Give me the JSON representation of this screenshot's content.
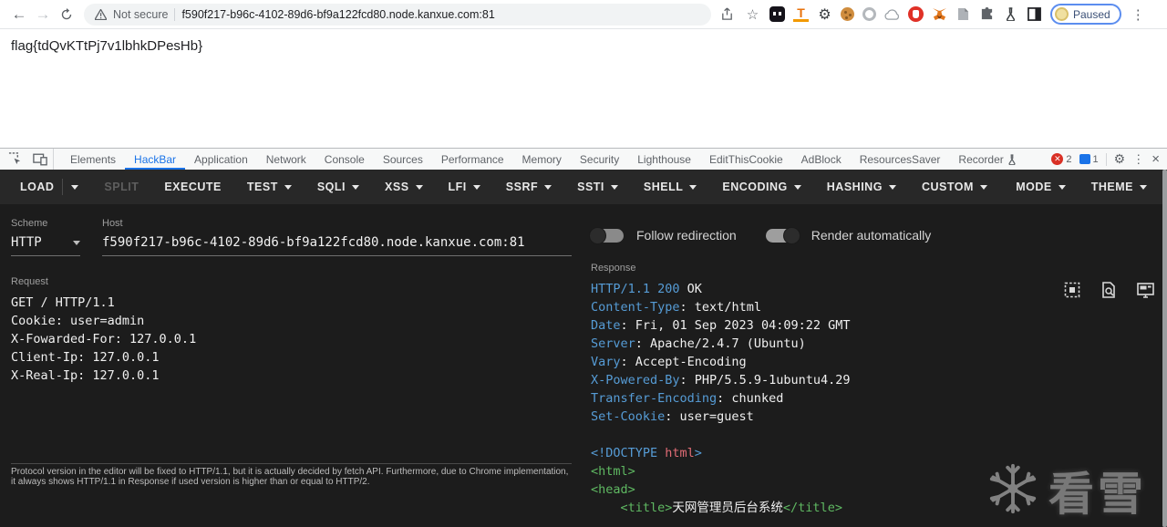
{
  "browser": {
    "back_icon": "←",
    "forward_icon": "→",
    "security_label": "Not secure",
    "url": "f590f217-b96c-4102-89d6-bf9a122fcd80.node.kanxue.com:81",
    "star_icon": "☆",
    "kebab_icon": "⋮",
    "profile_label": "Paused",
    "extension_icons": [
      "dark-reader",
      "orange-t",
      "gear",
      "cookie",
      "gray-ring",
      "cloud",
      "red-hand",
      "metamask-fox",
      "document",
      "puzzle",
      "flask",
      "split-window"
    ]
  },
  "page": {
    "flag_text": "flag{tdQvKTtPj7v1lbhkDPesHb}"
  },
  "devtools": {
    "tabs": [
      {
        "label": "Elements"
      },
      {
        "label": "HackBar",
        "active": true
      },
      {
        "label": "Application"
      },
      {
        "label": "Network"
      },
      {
        "label": "Console"
      },
      {
        "label": "Sources"
      },
      {
        "label": "Performance"
      },
      {
        "label": "Memory"
      },
      {
        "label": "Security"
      },
      {
        "label": "Lighthouse"
      },
      {
        "label": "EditThisCookie"
      },
      {
        "label": "AdBlock"
      },
      {
        "label": "ResourcesSaver"
      },
      {
        "label": "Recorder",
        "flask": true
      }
    ],
    "error_count": "2",
    "message_count": "1",
    "gear_icon": "⚙",
    "kebab_icon": "⋮",
    "close_icon": "×"
  },
  "hackbar": {
    "toolbar_left": [
      {
        "label": "LOAD",
        "split": true
      },
      {
        "label": "SPLIT",
        "disabled": true
      },
      {
        "label": "EXECUTE"
      },
      {
        "label": "TEST",
        "caret": true
      },
      {
        "label": "SQLI",
        "caret": true
      },
      {
        "label": "XSS",
        "caret": true
      },
      {
        "label": "LFI",
        "caret": true
      },
      {
        "label": "SSRF",
        "caret": true
      },
      {
        "label": "SSTI",
        "caret": true
      },
      {
        "label": "SHELL",
        "caret": true
      },
      {
        "label": "ENCODING",
        "caret": true
      },
      {
        "label": "HASHING",
        "caret": true
      },
      {
        "label": "CUSTOM",
        "caret": true
      }
    ],
    "toolbar_right": [
      {
        "label": "MODE",
        "caret": true
      },
      {
        "label": "THEME",
        "caret": true
      }
    ],
    "scheme_label": "Scheme",
    "scheme_value": "HTTP",
    "host_label": "Host",
    "host_value": "f590f217-b96c-4102-89d6-bf9a122fcd80.node.kanxue.com:81",
    "request_label": "Request",
    "request_lines": [
      "GET / HTTP/1.1",
      "Cookie: user=admin",
      "X-Fowarded-For: 127.0.0.1",
      "Client-Ip: 127.0.0.1",
      "X-Real-Ip: 127.0.0.1"
    ],
    "note": "Protocol version in the editor will be fixed to HTTP/1.1, but it is actually decided by fetch API. Furthermore, due to Chrome implementation, it always shows HTTP/1.1 in Response if used version is higher than or equal to HTTP/2.",
    "toggles": [
      {
        "label": "Follow redirection",
        "on": false
      },
      {
        "label": "Render automatically",
        "on": true
      }
    ],
    "response_label": "Response",
    "response_lines": [
      [
        {
          "t": "HTTP/1.1 200",
          "c": "b"
        },
        {
          "t": " OK",
          "c": "w"
        }
      ],
      [
        {
          "t": "Content-Type",
          "c": "b"
        },
        {
          "t": ": text/html",
          "c": "w"
        }
      ],
      [
        {
          "t": "Date",
          "c": "b"
        },
        {
          "t": ": Fri, 01 Sep 2023 04:09:22 GMT",
          "c": "w"
        }
      ],
      [
        {
          "t": "Server",
          "c": "b"
        },
        {
          "t": ": Apache/2.4.7 (Ubuntu)",
          "c": "w"
        }
      ],
      [
        {
          "t": "Vary",
          "c": "b"
        },
        {
          "t": ": Accept-Encoding",
          "c": "w"
        }
      ],
      [
        {
          "t": "X-Powered-By",
          "c": "b"
        },
        {
          "t": ": PHP/5.5.9-1ubuntu4.29",
          "c": "w"
        }
      ],
      [
        {
          "t": "Transfer-Encoding",
          "c": "b"
        },
        {
          "t": ": chunked",
          "c": "w"
        }
      ],
      [
        {
          "t": "Set-Cookie",
          "c": "b"
        },
        {
          "t": ": user=guest",
          "c": "w"
        }
      ],
      [],
      [
        {
          "t": "<!DOCTYPE ",
          "c": "b"
        },
        {
          "t": "html",
          "c": "r"
        },
        {
          "t": ">",
          "c": "b"
        }
      ],
      [
        {
          "t": "<html>",
          "c": "g"
        }
      ],
      [
        {
          "t": "<head>",
          "c": "g"
        }
      ],
      [
        {
          "t": "    ",
          "c": "w"
        },
        {
          "t": "<title>",
          "c": "g"
        },
        {
          "t": "天网管理员后台系统",
          "c": "w"
        },
        {
          "t": "</title>",
          "c": "g"
        }
      ]
    ]
  },
  "watermark": {
    "text": "看雪"
  },
  "colors": {
    "accent_blue": "#1a73e8",
    "key_blue": "#569cd6",
    "tag_green": "#5fb962",
    "attr_red": "#e06c75",
    "panel_bg": "#1c1c1c",
    "toolbar_bg": "#282828",
    "error_red": "#d93025"
  }
}
